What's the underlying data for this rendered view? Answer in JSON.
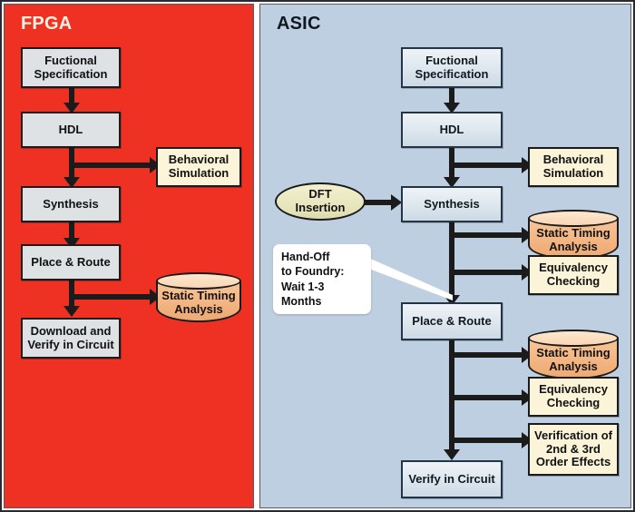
{
  "figure": {
    "panels": [
      {
        "id": "fpga",
        "title": "FPGA",
        "background_color": "#ef3124",
        "title_color": "#fdf3e3",
        "flow": [
          "Fuctional Specification",
          "HDL",
          "Synthesis",
          "Place & Route",
          "Download and Verify in Circuit"
        ],
        "outputs": [
          "Behavioral Simulation",
          "Static Timing Analysis"
        ]
      },
      {
        "id": "asic",
        "title": "ASIC",
        "background_color": "#bdcfe0",
        "title_color": "#101820",
        "flow": [
          "Fuctional Specification",
          "HDL",
          "Synthesis",
          "Place & Route",
          "Verify in Circuit"
        ],
        "outputs": [
          "Behavioral Simulation",
          "Static Timing Analysis",
          "Equivalency Checking",
          "Static Timing Analysis",
          "Equivalency Checking",
          "Verification of 2nd & 3rd Order Effects"
        ],
        "oval": "DFT Insertion",
        "callout": "Hand-Off to Foundry: Wait 1-3 Months"
      }
    ]
  },
  "fpga": {
    "title": "FPGA",
    "n1": "Fuctional\nSpecification",
    "n1_l1": "Fuctional",
    "n1_l2": "Specification",
    "n2": "HDL",
    "n3": "Synthesis",
    "n4": "Place & Route",
    "n5_l1": "Download and",
    "n5_l2": "Verify in Circuit",
    "o1_l1": "Behavioral",
    "o1_l2": "Simulation",
    "o2_l1": "Static Timing",
    "o2_l2": "Analysis"
  },
  "asic": {
    "title": "ASIC",
    "n1_l1": "Fuctional",
    "n1_l2": "Specification",
    "n2": "HDL",
    "n3": "Synthesis",
    "n4": "Place & Route",
    "n5": "Verify in Circuit",
    "oval_l1": "DFT",
    "oval_l2": "Insertion",
    "callout_l1": "Hand-Off",
    "callout_l2": "to Foundry:",
    "callout_l3": "Wait 1-3 Months",
    "o1_l1": "Behavioral",
    "o1_l2": "Simulation",
    "o2_l1": "Static Timing",
    "o2_l2": "Analysis",
    "o3_l1": "Equivalency",
    "o3_l2": "Checking",
    "o4_l1": "Static Timing",
    "o4_l2": "Analysis",
    "o5_l1": "Equivalency",
    "o5_l2": "Checking",
    "o6_l1": "Verification of",
    "o6_l2": "2nd & 3rd",
    "o6_l3": "Order Effects"
  }
}
